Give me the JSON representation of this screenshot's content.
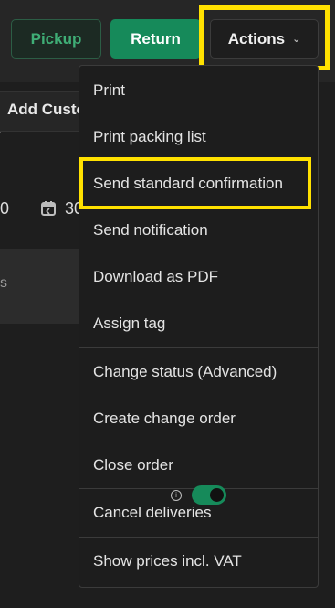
{
  "toolbar": {
    "pickup_label": "Pickup",
    "return_label": "Return",
    "actions_label": "Actions",
    "actions_chevron": "⌄"
  },
  "background": {
    "add_customer_label": "Add Custo",
    "number_fragment": "0",
    "date_fragment": "30",
    "text_fragment": "s"
  },
  "menu": {
    "items": [
      "Print",
      "Print packing list",
      "Send standard confirmation",
      "Send notification",
      "Download as PDF",
      "Assign tag",
      "Change status (Advanced)",
      "Create change order",
      "Close order",
      "Cancel deliveries"
    ],
    "vat_label": "Show prices incl. VAT",
    "vat_enabled": true
  },
  "colors": {
    "accent_green": "#168a5a",
    "highlight_yellow": "#ffe100"
  }
}
